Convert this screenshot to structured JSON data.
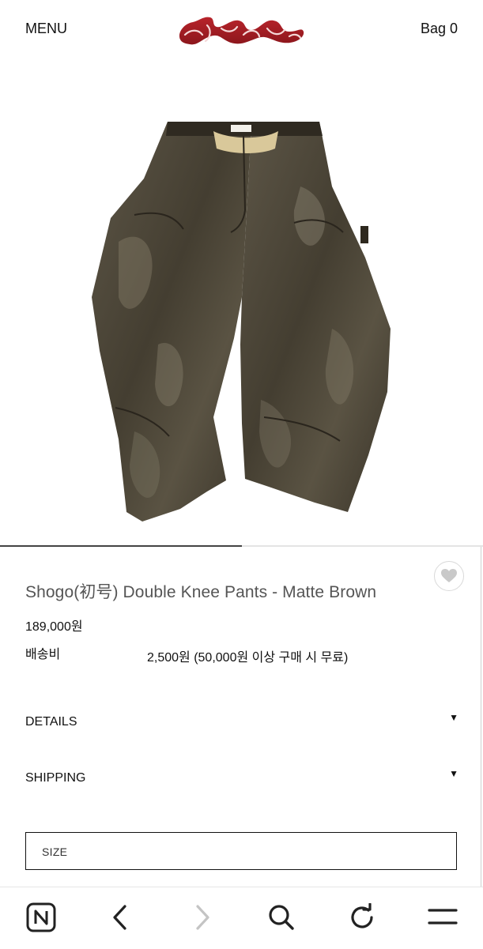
{
  "header": {
    "menu_label": "MENU",
    "bag_label": "Bag 0",
    "logo_text": "あおいろ",
    "logo_color": "#a31b22"
  },
  "product": {
    "image_icon": "brown-double-knee-pants-photo",
    "gallery_progress": 0.5,
    "title": "Shogo(初号) Double Knee Pants - Matte Brown",
    "price": "189,000원",
    "shipping_label": "배송비",
    "shipping_value": "2,500원 (50,000원 이상 구매 시 무료)",
    "wishlist_icon": "heart-icon"
  },
  "accordions": [
    {
      "label": "DETAILS",
      "icon": "caret-down-icon"
    },
    {
      "label": "SHIPPING",
      "icon": "caret-down-icon"
    }
  ],
  "size_select": {
    "label": "SIZE"
  },
  "browser_bar": {
    "icons": [
      "naver-n-icon",
      "back-chevron-icon",
      "forward-chevron-icon",
      "search-icon",
      "refresh-icon",
      "menu-lines-icon"
    ],
    "forward_disabled": true,
    "icon_color": "#222222",
    "disabled_color": "#c4c4c4"
  },
  "colors": {
    "pants_dark": "#3f3a2e",
    "pants_mid": "#5b5444",
    "pants_highlight": "#8a8472"
  }
}
